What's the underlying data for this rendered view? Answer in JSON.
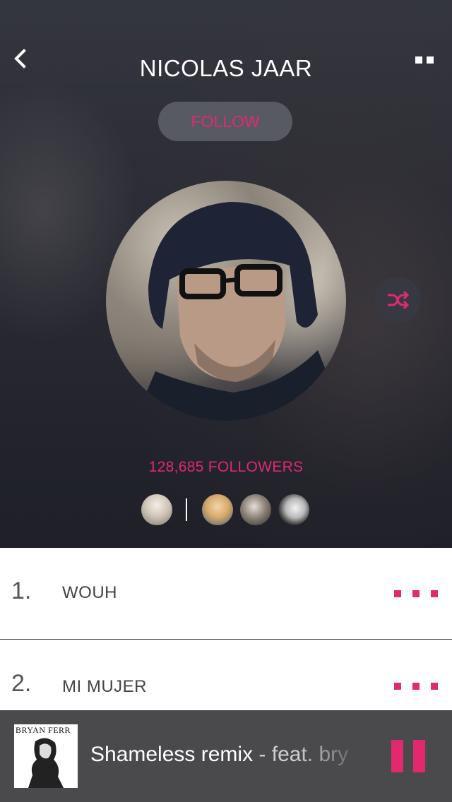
{
  "header": {
    "artist_name": "NICOLAS JAAR",
    "follow_label": "FOLLOW",
    "back_icon": "chevron-left-icon",
    "menu_icon": "menu-icon"
  },
  "profile": {
    "followers_label": "128,685 FOLLOWERS",
    "shuffle_icon": "shuffle-icon"
  },
  "tracks": [
    {
      "number": "1.",
      "title": "WOUH"
    },
    {
      "number": "2.",
      "title": "MI MUJER"
    }
  ],
  "now_playing": {
    "album_text": "BRYAN FERR",
    "title": "Shameless remix",
    "feat": " - feat. bry",
    "pause_icon": "pause-icon"
  },
  "colors": {
    "accent": "#e2296f",
    "player_bg": "#4a4a4c",
    "hero_bg": "#2f3039"
  }
}
